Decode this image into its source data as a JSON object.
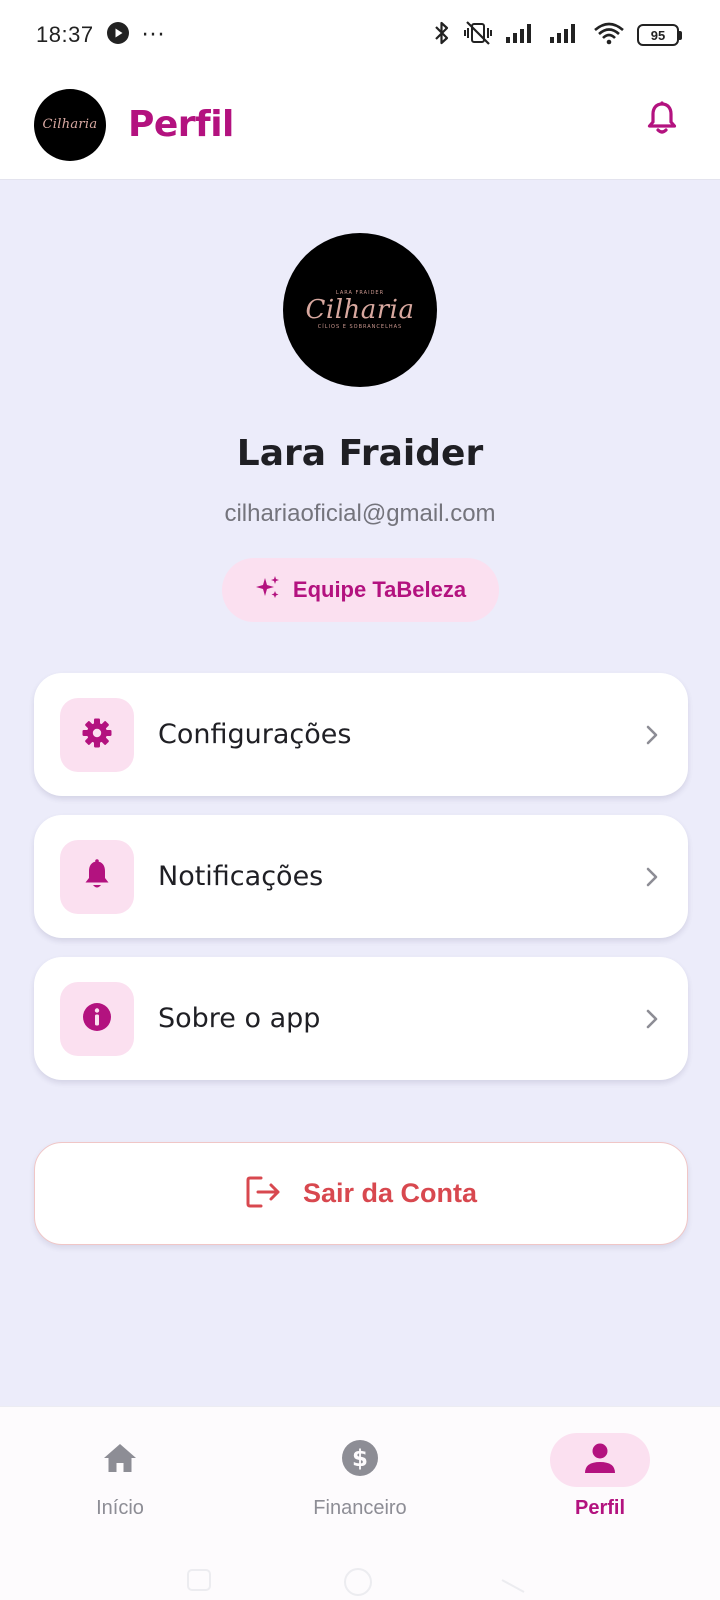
{
  "status_bar": {
    "time": "18:37",
    "more": "···",
    "battery": "95",
    "icons": [
      "play-icon",
      "bluetooth-icon",
      "vibrate-off-icon",
      "signal-icon",
      "signal-icon",
      "wifi-icon",
      "battery-icon"
    ]
  },
  "header": {
    "logo_text": "Cilharia",
    "title": "Perfil",
    "bell_icon": "bell-icon"
  },
  "profile": {
    "avatar_top": "LARA FRAIDER",
    "avatar_brand": "Cilharia",
    "avatar_bottom": "CÍLIOS E SOBRANCELHAS",
    "name": "Lara Fraider",
    "email": "cilhariaoficial@gmail.com",
    "badge": "Equipe TaBeleza"
  },
  "menu": {
    "items": [
      {
        "label": "Configurações",
        "icon": "gear-icon"
      },
      {
        "label": "Notificações",
        "icon": "bell-icon"
      },
      {
        "label": "Sobre o app",
        "icon": "info-icon"
      }
    ],
    "logout": "Sair da Conta"
  },
  "bottom_nav": {
    "items": [
      {
        "label": "Início",
        "icon": "home-icon",
        "active": false
      },
      {
        "label": "Financeiro",
        "icon": "dollar-icon",
        "active": false
      },
      {
        "label": "Perfil",
        "icon": "person-icon",
        "active": true
      }
    ]
  },
  "colors": {
    "primary": "#b3127f",
    "primary_light": "#fbe0f0",
    "background": "#ececfa",
    "danger": "#d8484f",
    "muted": "#8d8d95"
  }
}
